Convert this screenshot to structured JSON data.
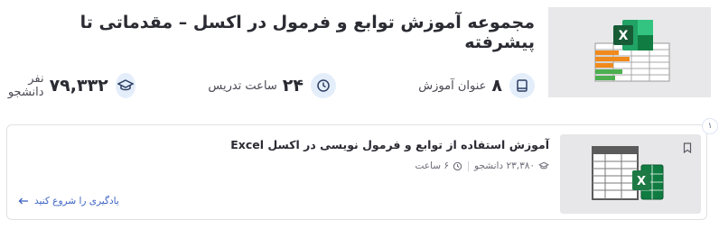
{
  "course_set": {
    "title": "مجموعه آموزش توابع و فرمول در اکسل – مقدماتی تا پیشرفته",
    "stats": {
      "courses_num": "۸",
      "courses_label": "عنوان آموزش",
      "hours_num": "۲۴",
      "hours_label": "ساعت تدریس",
      "students_num": "۷۹,۳۳۲",
      "students_label": "نفر دانشجو"
    }
  },
  "course_card": {
    "index": "۱",
    "title": "آموزش استفاده از توابع و فرمول نویسی در اکسل Excel",
    "students": "۲۳,۳۸۰ دانشجو",
    "hours": "۶ ساعت",
    "start_link": "یادگیری را شروع کنید"
  },
  "colors": {
    "excel_green": "#1f7244",
    "icon_bg": "#e4eefb",
    "link_blue": "#3d63c2"
  }
}
